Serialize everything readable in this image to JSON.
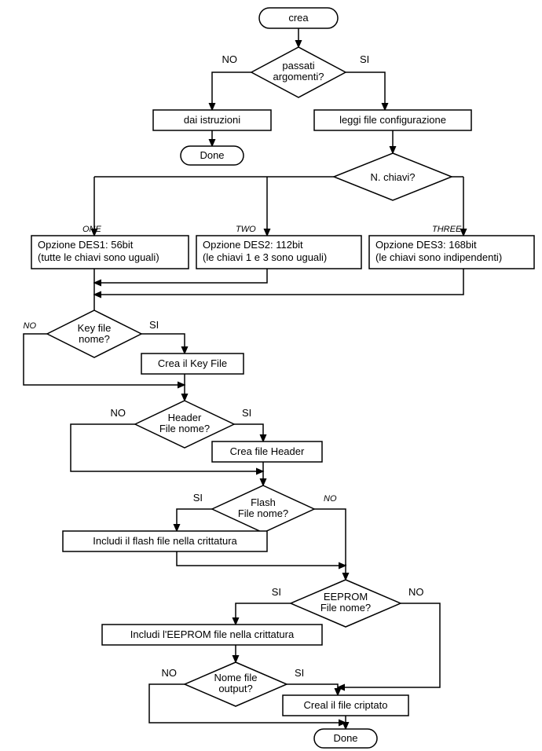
{
  "start": "crea",
  "decision_args": "passati\nargomenti?",
  "args_no": "NO",
  "args_si": "SI",
  "instr": "dai istruzioni",
  "done1": "Done",
  "read_conf": "leggi file configurazione",
  "nkeys": "N. chiavi?",
  "branch1_label": "ONE",
  "branch2_label": "TWO",
  "branch3_label": "THREE",
  "des1_l1": "Opzione DES1: 56bit",
  "des1_l2": "(tutte le chiavi sono uguali)",
  "des2_l1": "Opzione DES2: 112bit",
  "des2_l2": "(le chiavi 1 e 3 sono uguali)",
  "des3_l1": "Opzione DES3: 168bit",
  "des3_l2": "(le chiavi sono indipendenti)",
  "keyfile_dec": "Key file\nnome?",
  "kf_no": "NO",
  "kf_si": "SI",
  "crea_kf": "Crea il Key File",
  "header_dec": "Header\nFile nome?",
  "hd_no": "NO",
  "hd_si": "SI",
  "crea_hdr": "Crea file Header",
  "flash_dec": "Flash\nFile nome?",
  "fl_si": "SI",
  "fl_no": "NO",
  "incl_flash": "Includi il flash file nella crittatura",
  "eeprom_dec": "EEPROM\nFile nome?",
  "ee_si": "SI",
  "ee_no": "NO",
  "incl_eeprom": "Includi l'EEPROM file nella crittatura",
  "output_dec": "Nome file\noutput?",
  "out_no": "NO",
  "out_si": "SI",
  "crea_out": "Creal il file criptato",
  "done2": "Done"
}
